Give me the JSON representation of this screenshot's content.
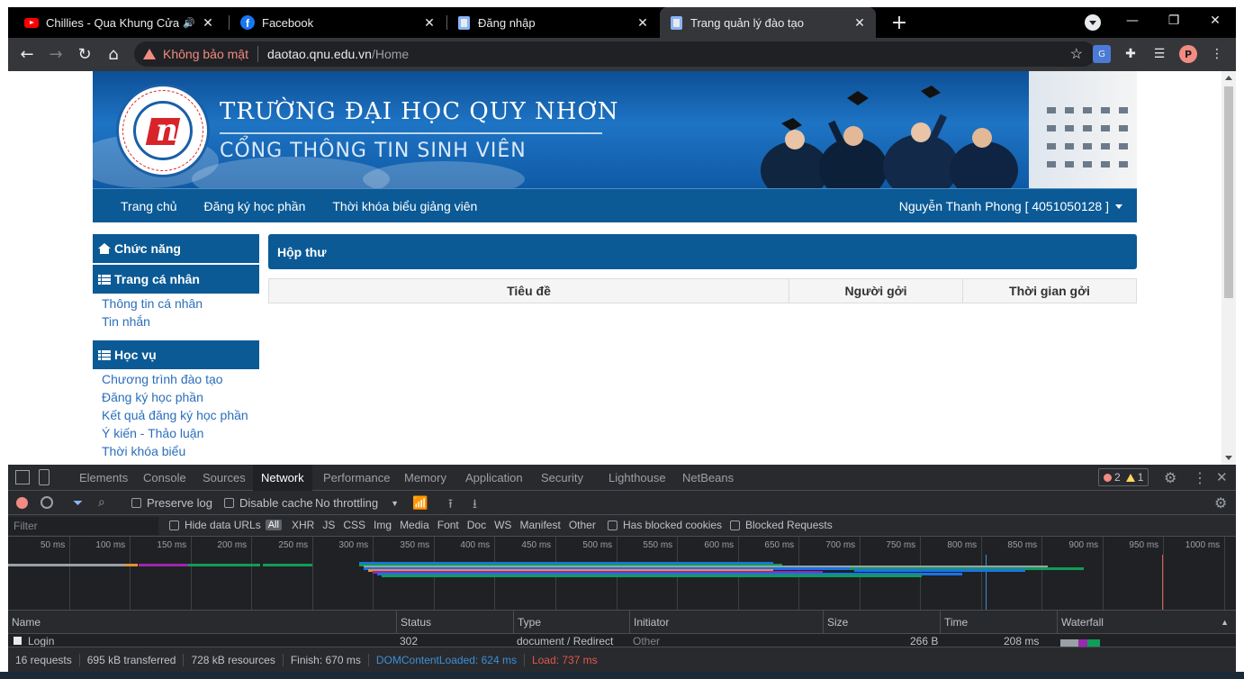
{
  "browser": {
    "tabs": [
      {
        "title": "Chillies - Qua Khung Cửa Sổ",
        "icon": "youtube-icon",
        "audio": "🔊"
      },
      {
        "title": "Facebook",
        "icon": "facebook-icon"
      },
      {
        "title": "Đăng nhập",
        "icon": "page-icon"
      },
      {
        "title": "Trang quản lý đào tạo",
        "icon": "page-icon"
      }
    ],
    "address": {
      "security": "Không bảo mật",
      "host": "daotao.qnu.edu.vn",
      "path": "/Home"
    },
    "profile_initial": "P"
  },
  "site": {
    "logo_text": "n",
    "title": "TRƯỜNG ĐẠI HỌC QUY NHƠN",
    "subtitle": "CỔNG THÔNG TIN SINH VIÊN",
    "nav": [
      "Trang chủ",
      "Đăng ký học phần",
      "Thời khóa biểu giảng viên"
    ],
    "user": "Nguyễn Thanh Phong [ 4051050128 ]",
    "sidebar": {
      "function_heading": "Chức năng",
      "personal_heading": "Trang cá nhân",
      "personal_links": [
        "Thông tin cá nhân",
        "Tin nhắn"
      ],
      "academic_heading": "Học vụ",
      "academic_links": [
        "Chương trình đào tạo",
        "Đăng ký học phần",
        "Kết quả đăng ký học phần",
        "Ý kiến - Thảo luận",
        "Thời khóa biểu"
      ]
    },
    "inbox": {
      "heading": "Hộp thư",
      "columns": [
        "Tiêu đề",
        "Người gởi",
        "Thời gian gởi"
      ]
    }
  },
  "devtools": {
    "tabs": [
      "Elements",
      "Console",
      "Sources",
      "Network",
      "Performance",
      "Memory",
      "Application",
      "Security",
      "Lighthouse",
      "NetBeans"
    ],
    "active_tab": "Network",
    "errors": "2",
    "warnings": "1",
    "toolbar": {
      "preserve_log": "Preserve log",
      "disable_cache": "Disable cache",
      "throttling": "No throttling"
    },
    "filter": {
      "placeholder": "Filter",
      "hide_data_urls": "Hide data URLs",
      "all": "All",
      "types": [
        "XHR",
        "JS",
        "CSS",
        "Img",
        "Media",
        "Font",
        "Doc",
        "WS",
        "Manifest",
        "Other"
      ],
      "has_blocked_cookies": "Has blocked cookies",
      "blocked_requests": "Blocked Requests"
    },
    "timeline_ticks": [
      "50 ms",
      "100 ms",
      "150 ms",
      "200 ms",
      "250 ms",
      "300 ms",
      "350 ms",
      "400 ms",
      "450 ms",
      "500 ms",
      "550 ms",
      "600 ms",
      "650 ms",
      "700 ms",
      "750 ms",
      "800 ms",
      "850 ms",
      "900 ms",
      "950 ms",
      "1000 ms"
    ],
    "columns": [
      "Name",
      "Status",
      "Type",
      "Initiator",
      "Size",
      "Time",
      "Waterfall"
    ],
    "row": {
      "name": "Login",
      "status": "302",
      "type": "document / Redirect",
      "initiator": "Other",
      "size": "266 B",
      "time": "208 ms"
    },
    "status": {
      "requests": "16 requests",
      "transferred": "695 kB transferred",
      "resources": "728 kB resources",
      "finish": "Finish: 670 ms",
      "dcl": "DOMContentLoaded: 624 ms",
      "load": "Load: 737 ms"
    },
    "colors": {
      "dcl": "#3b8fd9",
      "load": "#e2574c"
    }
  }
}
